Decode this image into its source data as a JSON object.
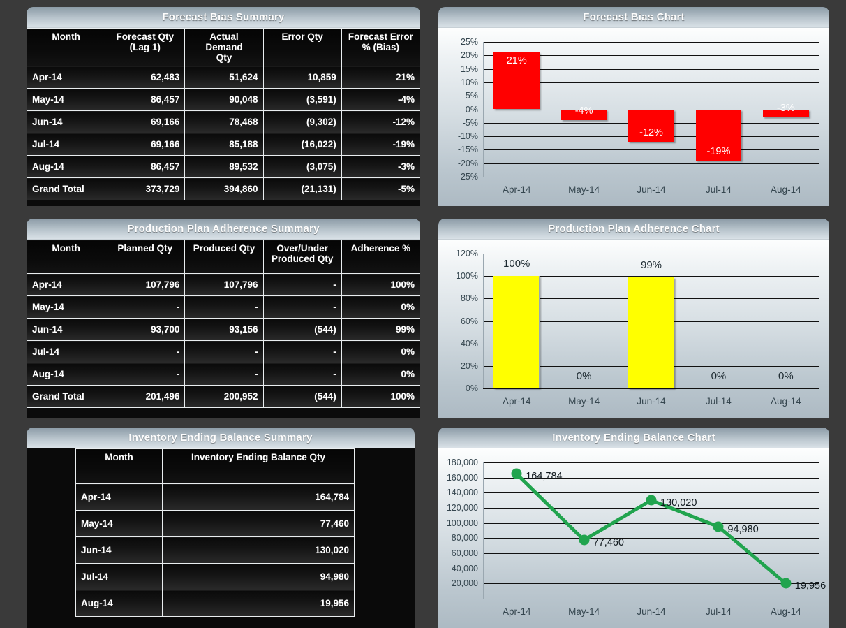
{
  "panels": {
    "forecast_bias_summary": "Forecast Bias Summary",
    "forecast_bias_chart": "Forecast Bias Chart",
    "production_plan_summary": "Production Plan Adherence Summary",
    "production_plan_chart": "Production Plan Adherence Chart",
    "inventory_summary": "Inventory Ending Balance Summary",
    "inventory_chart": "Inventory Ending Balance Chart"
  },
  "forecast_bias_table": {
    "columns": [
      "Month",
      "Forecast Qty (Lag 1)",
      "Actual Demand Qty",
      "Error Qty",
      "Forecast Error % (Bias)"
    ],
    "columns_lines": [
      [
        "Month"
      ],
      [
        "Forecast Qty",
        "(Lag 1)"
      ],
      [
        "Actual Demand",
        "Qty"
      ],
      [
        "Error Qty"
      ],
      [
        "Forecast Error",
        "% (Bias)"
      ]
    ],
    "rows": [
      {
        "month": "Apr-14",
        "forecast_qty": "62,483",
        "actual_demand_qty": "51,624",
        "error_qty": "10,859",
        "bias_pct": "21%"
      },
      {
        "month": "May-14",
        "forecast_qty": "86,457",
        "actual_demand_qty": "90,048",
        "error_qty": "(3,591)",
        "bias_pct": "-4%"
      },
      {
        "month": "Jun-14",
        "forecast_qty": "69,166",
        "actual_demand_qty": "78,468",
        "error_qty": "(9,302)",
        "bias_pct": "-12%"
      },
      {
        "month": "Jul-14",
        "forecast_qty": "69,166",
        "actual_demand_qty": "85,188",
        "error_qty": "(16,022)",
        "bias_pct": "-19%"
      },
      {
        "month": "Aug-14",
        "forecast_qty": "86,457",
        "actual_demand_qty": "89,532",
        "error_qty": "(3,075)",
        "bias_pct": "-3%"
      },
      {
        "month": "Grand Total",
        "forecast_qty": "373,729",
        "actual_demand_qty": "394,860",
        "error_qty": "(21,131)",
        "bias_pct": "-5%"
      }
    ]
  },
  "production_plan_table": {
    "columns": [
      "Month",
      "Planned Qty",
      "Produced Qty",
      "Over/Under Produced Qty",
      "Adherence %"
    ],
    "columns_lines": [
      [
        "Month"
      ],
      [
        "Planned Qty"
      ],
      [
        "Produced Qty"
      ],
      [
        "Over/Under",
        "Produced Qty"
      ],
      [
        "Adherence %"
      ]
    ],
    "rows": [
      {
        "month": "Apr-14",
        "planned_qty": "107,796",
        "produced_qty": "107,796",
        "over_under_qty": "-",
        "adherence_pct": "100%"
      },
      {
        "month": "May-14",
        "planned_qty": "-",
        "produced_qty": "-",
        "over_under_qty": "-",
        "adherence_pct": "0%"
      },
      {
        "month": "Jun-14",
        "planned_qty": "93,700",
        "produced_qty": "93,156",
        "over_under_qty": "(544)",
        "adherence_pct": "99%"
      },
      {
        "month": "Jul-14",
        "planned_qty": "-",
        "produced_qty": "-",
        "over_under_qty": "-",
        "adherence_pct": "0%"
      },
      {
        "month": "Aug-14",
        "planned_qty": "-",
        "produced_qty": "-",
        "over_under_qty": "-",
        "adherence_pct": "0%"
      },
      {
        "month": "Grand Total",
        "planned_qty": "201,496",
        "produced_qty": "200,952",
        "over_under_qty": "(544)",
        "adherence_pct": "100%"
      }
    ]
  },
  "inventory_table": {
    "columns": [
      "Month",
      "Inventory Ending Balance Qty"
    ],
    "rows": [
      {
        "month": "Apr-14",
        "ending_balance_qty": "164,784"
      },
      {
        "month": "May-14",
        "ending_balance_qty": "77,460"
      },
      {
        "month": "Jun-14",
        "ending_balance_qty": "130,020"
      },
      {
        "month": "Jul-14",
        "ending_balance_qty": "94,980"
      },
      {
        "month": "Aug-14",
        "ending_balance_qty": "19,956"
      }
    ]
  },
  "colors": {
    "bar_red": "#ff0000",
    "bar_yellow": "#ffff00",
    "line_green": "#21a44e",
    "panel_bg": "#0c0c0c",
    "dashboard_bg": "#3a3a3a",
    "header_gradient_top": "#8c9ba7",
    "header_gradient_bottom": "#d9e1e7",
    "axis_text": "#35464f"
  },
  "chart_data": [
    {
      "id": "forecast_bias_chart",
      "type": "bar",
      "title": "Forecast Bias Chart",
      "xlabel": "",
      "ylabel": "",
      "categories": [
        "Apr-14",
        "May-14",
        "Jun-14",
        "Jul-14",
        "Aug-14"
      ],
      "values": [
        21,
        -4,
        -12,
        -19,
        -3
      ],
      "data_labels": [
        "21%",
        "-4%",
        "-12%",
        "-19%",
        "-3%"
      ],
      "ylim": [
        -25,
        25
      ],
      "ytick_step": 5,
      "ytick_labels": [
        "25%",
        "20%",
        "15%",
        "10%",
        "5%",
        "0%",
        "-5%",
        "-10%",
        "-15%",
        "-20%",
        "-25%"
      ],
      "grid": true,
      "legend": "none",
      "series_color": "#ff0000"
    },
    {
      "id": "production_plan_adherence_chart",
      "type": "bar",
      "title": "Production Plan Adherence Chart",
      "xlabel": "",
      "ylabel": "",
      "categories": [
        "Apr-14",
        "May-14",
        "Jun-14",
        "Jul-14",
        "Aug-14"
      ],
      "values": [
        100,
        0,
        99,
        0,
        0
      ],
      "data_labels": [
        "100%",
        "0%",
        "99%",
        "0%",
        "0%"
      ],
      "ylim": [
        0,
        120
      ],
      "ytick_step": 20,
      "ytick_labels": [
        "120%",
        "100%",
        "80%",
        "60%",
        "40%",
        "20%",
        "0%"
      ],
      "grid": true,
      "legend": "none",
      "series_color": "#ffff00"
    },
    {
      "id": "inventory_ending_balance_chart",
      "type": "line",
      "title": "Inventory Ending Balance Chart",
      "xlabel": "",
      "ylabel": "",
      "categories": [
        "Apr-14",
        "May-14",
        "Jun-14",
        "Jul-14",
        "Aug-14"
      ],
      "values": [
        164784,
        77460,
        130020,
        94980,
        19956
      ],
      "data_labels": [
        "164,784",
        "77,460",
        "130,020",
        "94,980",
        "19,956"
      ],
      "ylim": [
        0,
        180000
      ],
      "ytick_step": 20000,
      "ytick_labels": [
        "180,000",
        "160,000",
        "140,000",
        "120,000",
        "100,000",
        "80,000",
        "60,000",
        "40,000",
        "20,000",
        "-"
      ],
      "grid": true,
      "legend": "none",
      "series_color": "#21a44e",
      "marker": "circle"
    }
  ]
}
